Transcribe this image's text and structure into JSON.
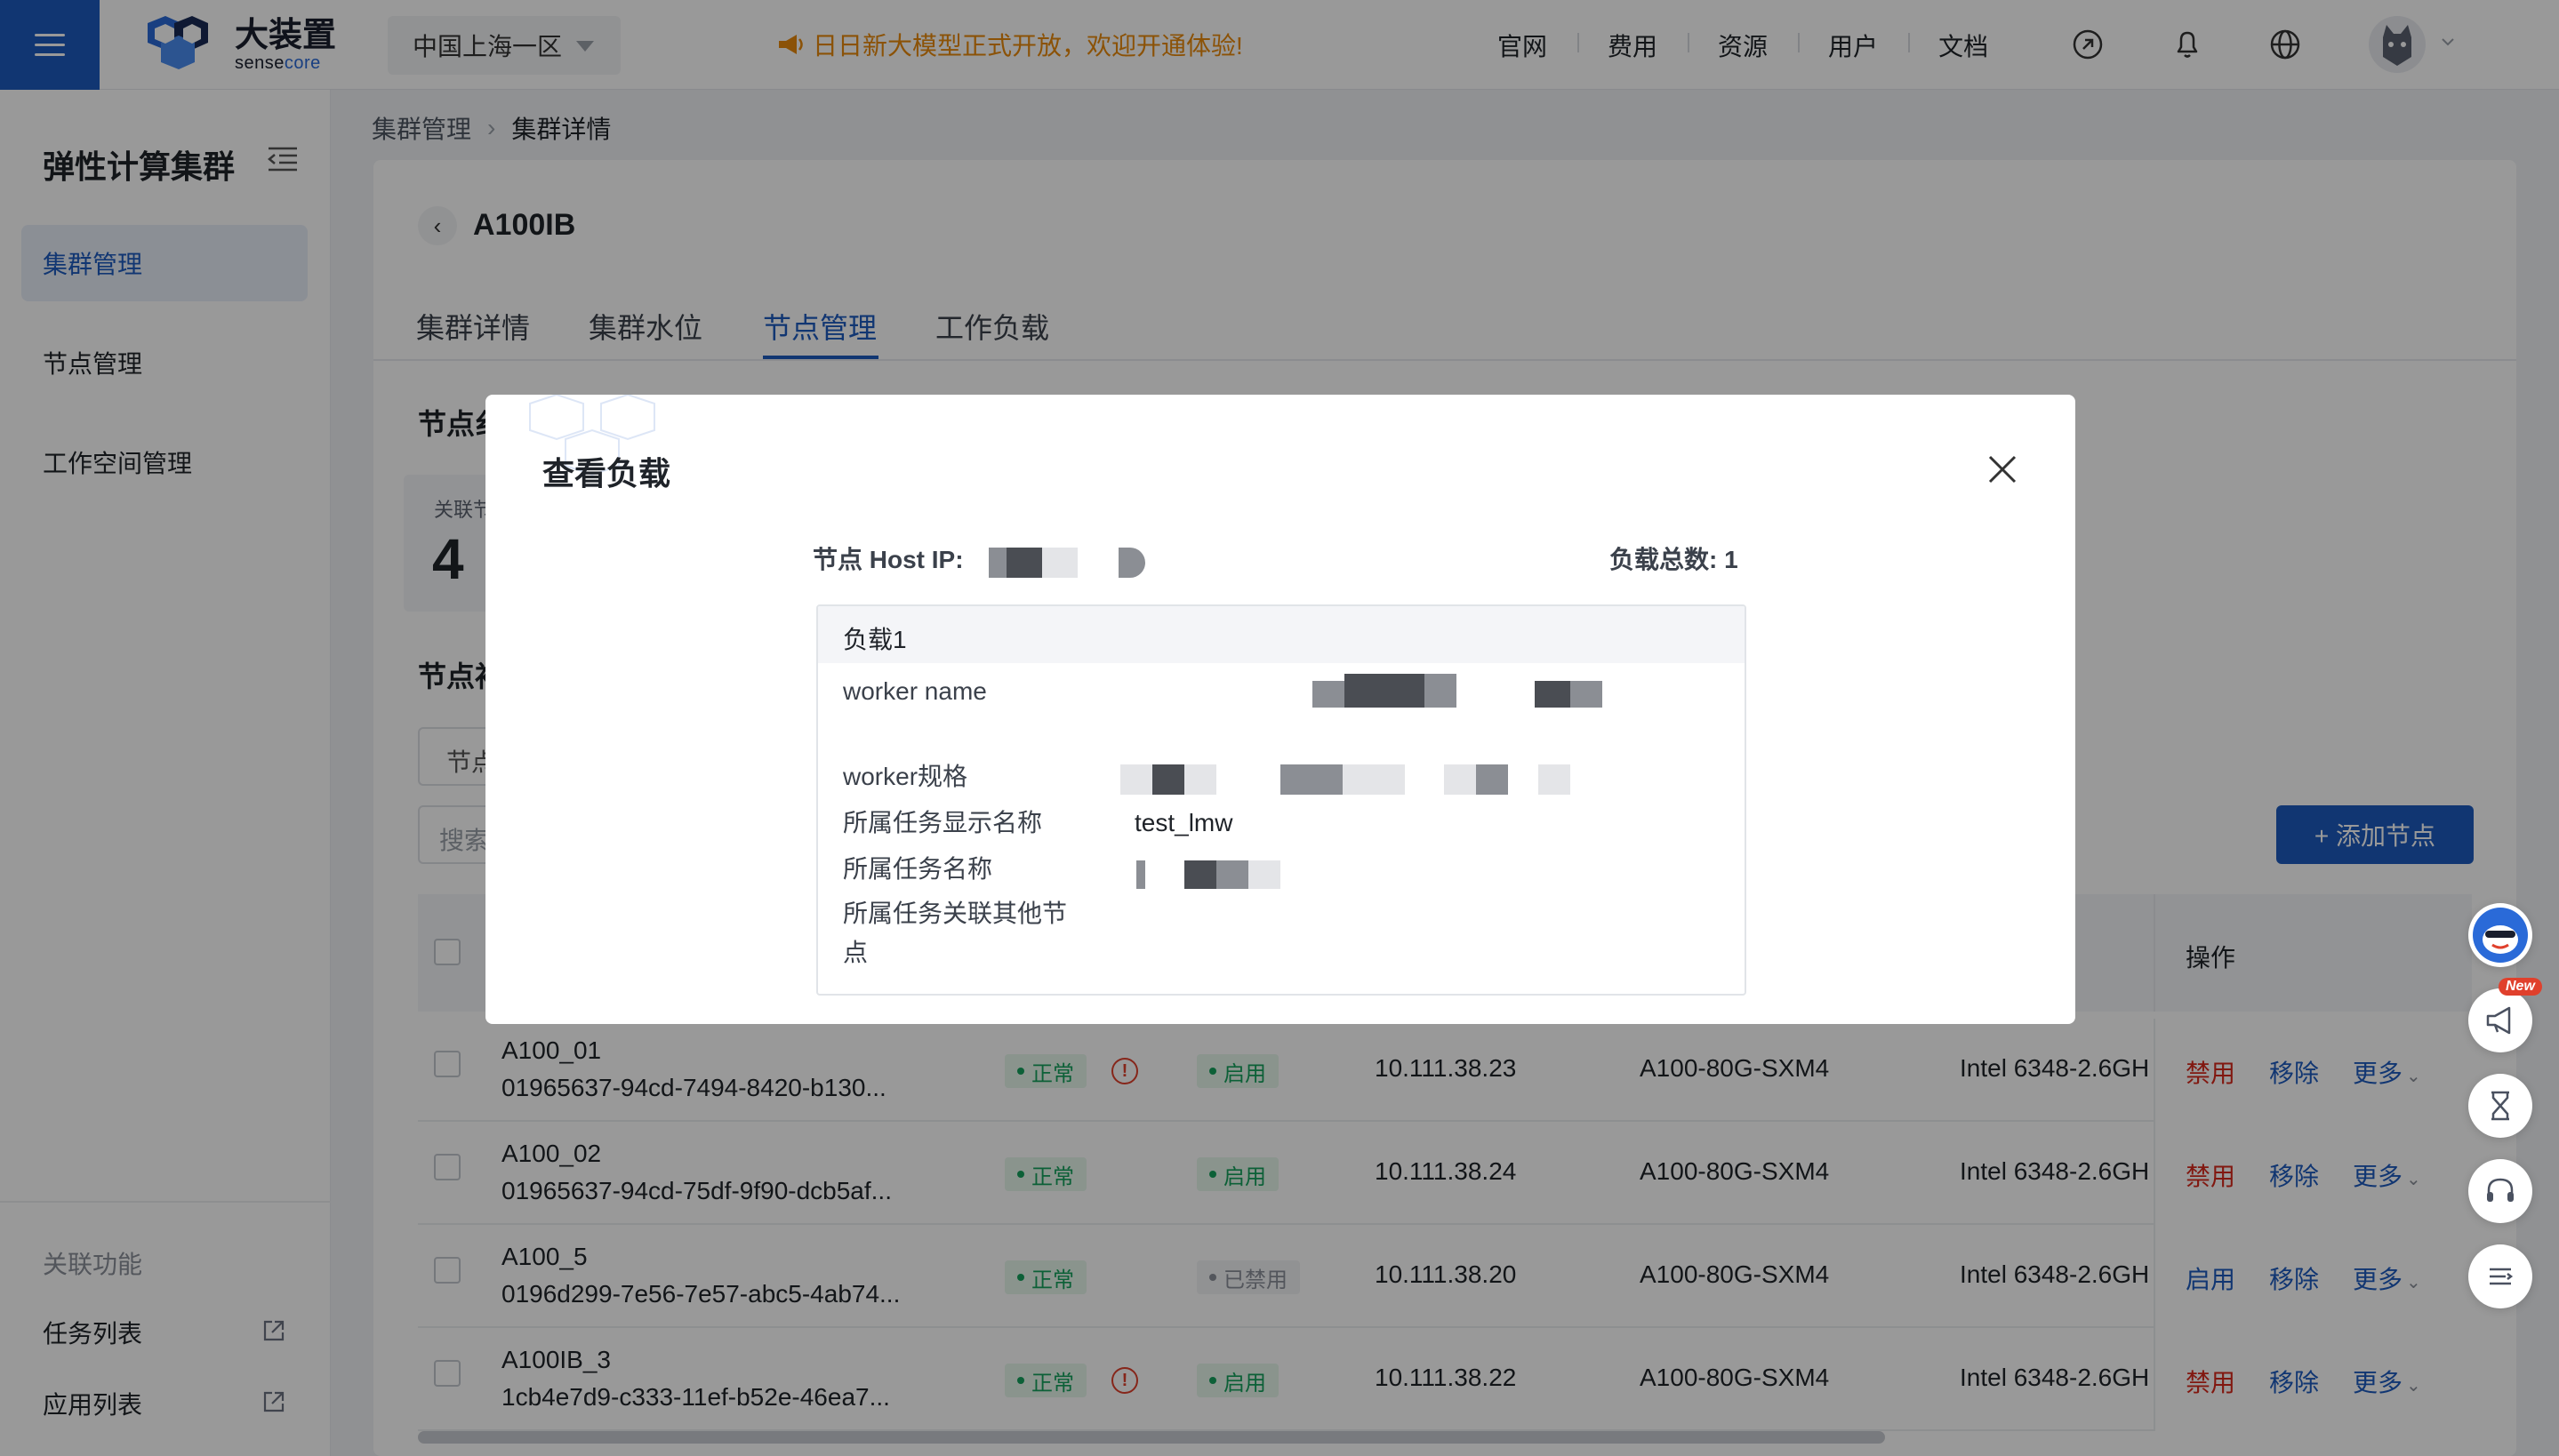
{
  "header": {
    "brand_cn": "大装置",
    "brand_en_a": "sense",
    "brand_en_b": "core",
    "region": "中国上海一区",
    "announcement": "日日新大模型正式开放，欢迎开通体验!",
    "nav": [
      "官网",
      "费用",
      "资源",
      "用户",
      "文档"
    ],
    "icons": [
      "menu-icon",
      "region-caret-icon",
      "horn-icon",
      "link-icon",
      "bell-icon",
      "globe-icon",
      "avatar",
      "chevron-down-icon"
    ]
  },
  "sidebar": {
    "title": "弹性计算集群",
    "items": [
      {
        "label": "集群管理",
        "active": true
      },
      {
        "label": "节点管理",
        "active": false
      },
      {
        "label": "工作空间管理",
        "active": false
      }
    ],
    "related_label": "关联功能",
    "links": [
      {
        "label": "任务列表"
      },
      {
        "label": "应用列表"
      }
    ]
  },
  "breadcrumb": [
    "集群管理",
    "集群详情"
  ],
  "cluster": {
    "name": "A100IB",
    "tabs": [
      "集群详情",
      "集群水位",
      "节点管理",
      "工作负载"
    ],
    "active_tab": "节点管理"
  },
  "section": {
    "overview_title": "节点纟",
    "stat_label": "关联节",
    "stat_value": "4",
    "list_title": "节点衫",
    "filter_label": "节点",
    "search_placeholder": "搜索",
    "add_button": "+ 添加节点"
  },
  "table": {
    "ops_header": "操作",
    "rows": [
      {
        "name": "A100_01",
        "uid": "01965637-94cd-7494-8420-b130...",
        "status": "正常",
        "warn": true,
        "enabled": "启用",
        "enabled_on": true,
        "ip": "10.111.38.23",
        "gpu": "A100-80G-SXM4",
        "cpu": "Intel 6348-2.6GH",
        "op1": "禁用",
        "op2": "移除",
        "op3": "更多"
      },
      {
        "name": "A100_02",
        "uid": "01965637-94cd-75df-9f90-dcb5af...",
        "status": "正常",
        "warn": false,
        "enabled": "启用",
        "enabled_on": true,
        "ip": "10.111.38.24",
        "gpu": "A100-80G-SXM4",
        "cpu": "Intel 6348-2.6GH",
        "op1": "禁用",
        "op2": "移除",
        "op3": "更多"
      },
      {
        "name": "A100_5",
        "uid": "0196d299-7e56-7e57-abc5-4ab74...",
        "status": "正常",
        "warn": false,
        "enabled": "已禁用",
        "enabled_on": false,
        "ip": "10.111.38.20",
        "gpu": "A100-80G-SXM4",
        "cpu": "Intel 6348-2.6GH",
        "op1": "启用",
        "op2": "移除",
        "op3": "更多"
      },
      {
        "name": "A100IB_3",
        "uid": "1cb4e7d9-c333-11ef-b52e-46ea7...",
        "status": "正常",
        "warn": true,
        "enabled": "启用",
        "enabled_on": true,
        "ip": "10.111.38.22",
        "gpu": "A100-80G-SXM4",
        "cpu": "Intel 6348-2.6GH",
        "op1": "禁用",
        "op2": "移除",
        "op3": "更多"
      }
    ]
  },
  "modal": {
    "title": "查看负载",
    "host_label": "节点 Host IP:",
    "total_label": "负载总数: 1",
    "card_title": "负载1",
    "fields": {
      "worker_name": "worker name",
      "worker_spec": "worker规格",
      "task_display_name": "所属任务显示名称",
      "task_display_name_value": "test_lmw",
      "task_name": "所属任务名称",
      "task_other_nodes_1": "所属任务关联其他节",
      "task_other_nodes_2": "点"
    }
  },
  "float_tools": {
    "new_badge": "New",
    "icons": [
      "assistant-icon",
      "megaphone-icon",
      "hourglass-icon",
      "headset-icon",
      "menu-collapse-icon"
    ]
  },
  "colors": {
    "primary": "#1d5bbf",
    "danger": "#d8281c",
    "success": "#15a15c",
    "warning_text": "#e8890c"
  }
}
